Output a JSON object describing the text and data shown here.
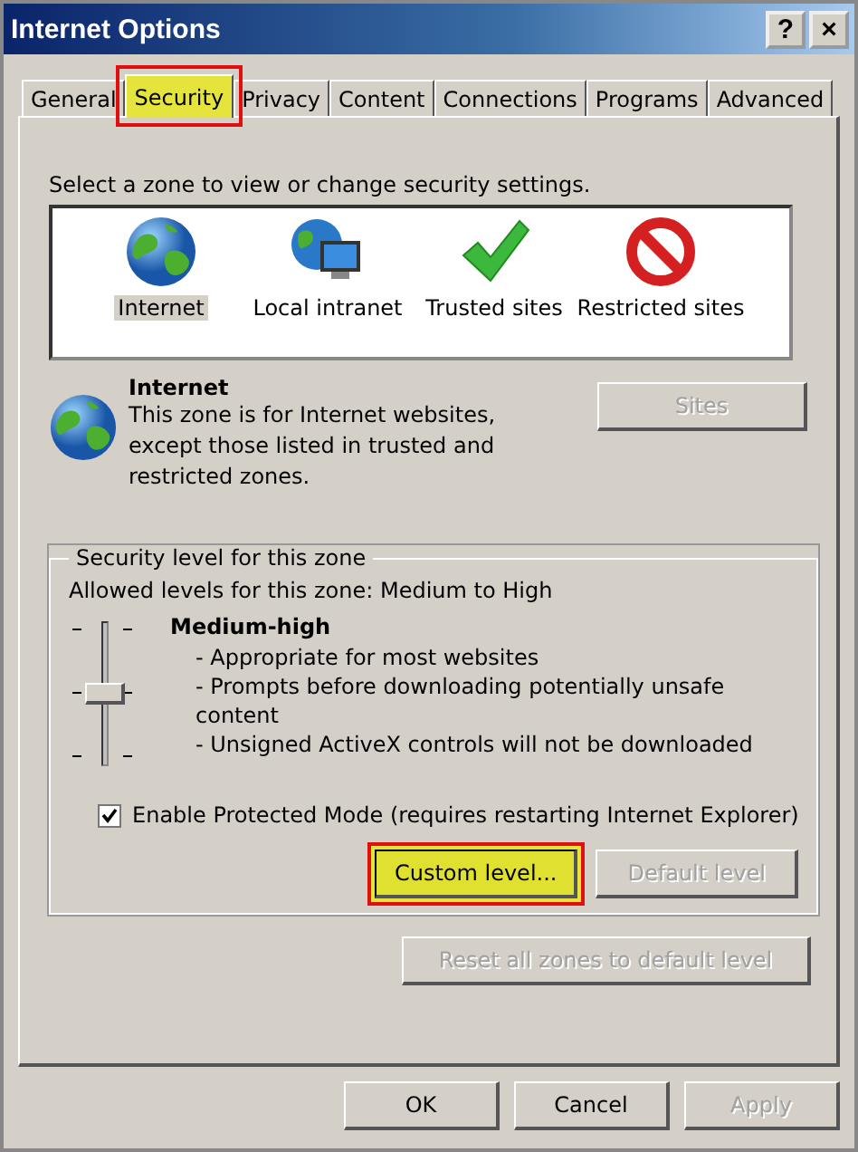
{
  "window": {
    "title": "Internet Options",
    "title_buttons": [
      "?",
      "×"
    ]
  },
  "tabs": [
    {
      "label": "General",
      "selected": false,
      "highlighted": false
    },
    {
      "label": "Security",
      "selected": true,
      "highlighted": true
    },
    {
      "label": "Privacy",
      "selected": false,
      "highlighted": false
    },
    {
      "label": "Content",
      "selected": false,
      "highlighted": false
    },
    {
      "label": "Connections",
      "selected": false,
      "highlighted": false
    },
    {
      "label": "Programs",
      "selected": false,
      "highlighted": false
    },
    {
      "label": "Advanced",
      "selected": false,
      "highlighted": false
    }
  ],
  "zones": {
    "prompt": "Select a zone to view or change security settings.",
    "items": [
      {
        "label": "Internet",
        "kind": "globe",
        "selected": true
      },
      {
        "label": "Local intranet",
        "kind": "intranet",
        "selected": false
      },
      {
        "label": "Trusted sites",
        "kind": "check",
        "selected": false
      },
      {
        "label": "Restricted sites",
        "kind": "restricted",
        "selected": false
      }
    ]
  },
  "zone_info": {
    "title": "Internet",
    "description": "This zone is for Internet websites, except those listed in trusted and restricted zones.",
    "sites_button": {
      "label": "Sites",
      "disabled": true
    }
  },
  "security_level": {
    "legend": "Security level for this zone",
    "allowed": "Allowed levels for this zone: Medium to High",
    "slider": {
      "level": 0.5
    },
    "level_name": "Medium-high",
    "bullets": [
      "- Appropriate for most websites",
      "- Prompts before downloading potentially unsafe content",
      "- Unsigned ActiveX controls will not be downloaded"
    ],
    "protected_mode": {
      "label": "Enable Protected Mode (requires restarting Internet Explorer)",
      "checked": true
    },
    "custom_button": {
      "label": "Custom level...",
      "disabled": false,
      "highlighted": true
    },
    "default_button": {
      "label": "Default level",
      "disabled": true,
      "highlighted": false
    }
  },
  "reset_button": {
    "label": "Reset all zones to default level",
    "disabled": true
  },
  "footer_buttons": [
    {
      "label": "OK",
      "disabled": false
    },
    {
      "label": "Cancel",
      "disabled": false
    },
    {
      "label": "Apply",
      "disabled": true
    }
  ]
}
